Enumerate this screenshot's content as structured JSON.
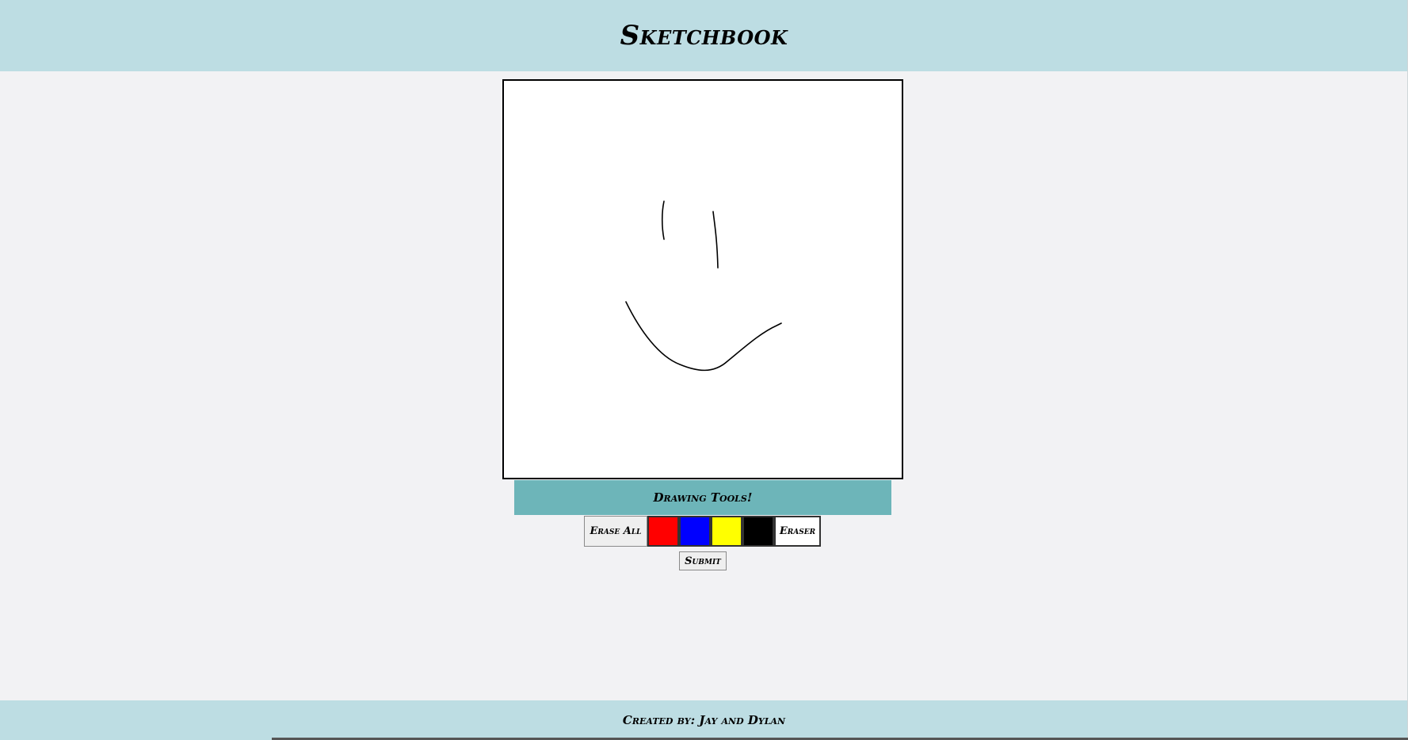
{
  "header": {
    "title": "Sketchbook"
  },
  "canvas": {
    "background": "#ffffff",
    "stroke_color": "#000000"
  },
  "tools": {
    "label": "Drawing Tools!",
    "erase_all_label": "Erase All",
    "swatches": [
      {
        "name": "red",
        "color": "#ff0000"
      },
      {
        "name": "blue",
        "color": "#0000ff"
      },
      {
        "name": "yellow",
        "color": "#ffff00"
      },
      {
        "name": "black",
        "color": "#000000"
      }
    ],
    "eraser_label": "Eraser",
    "submit_label": "Submit"
  },
  "footer": {
    "credit": "Created by: Jay and Dylan"
  },
  "colors": {
    "header_bg": "#bddde3",
    "page_bg": "#f2f2f4",
    "tools_bar_bg": "#6db5b9"
  }
}
